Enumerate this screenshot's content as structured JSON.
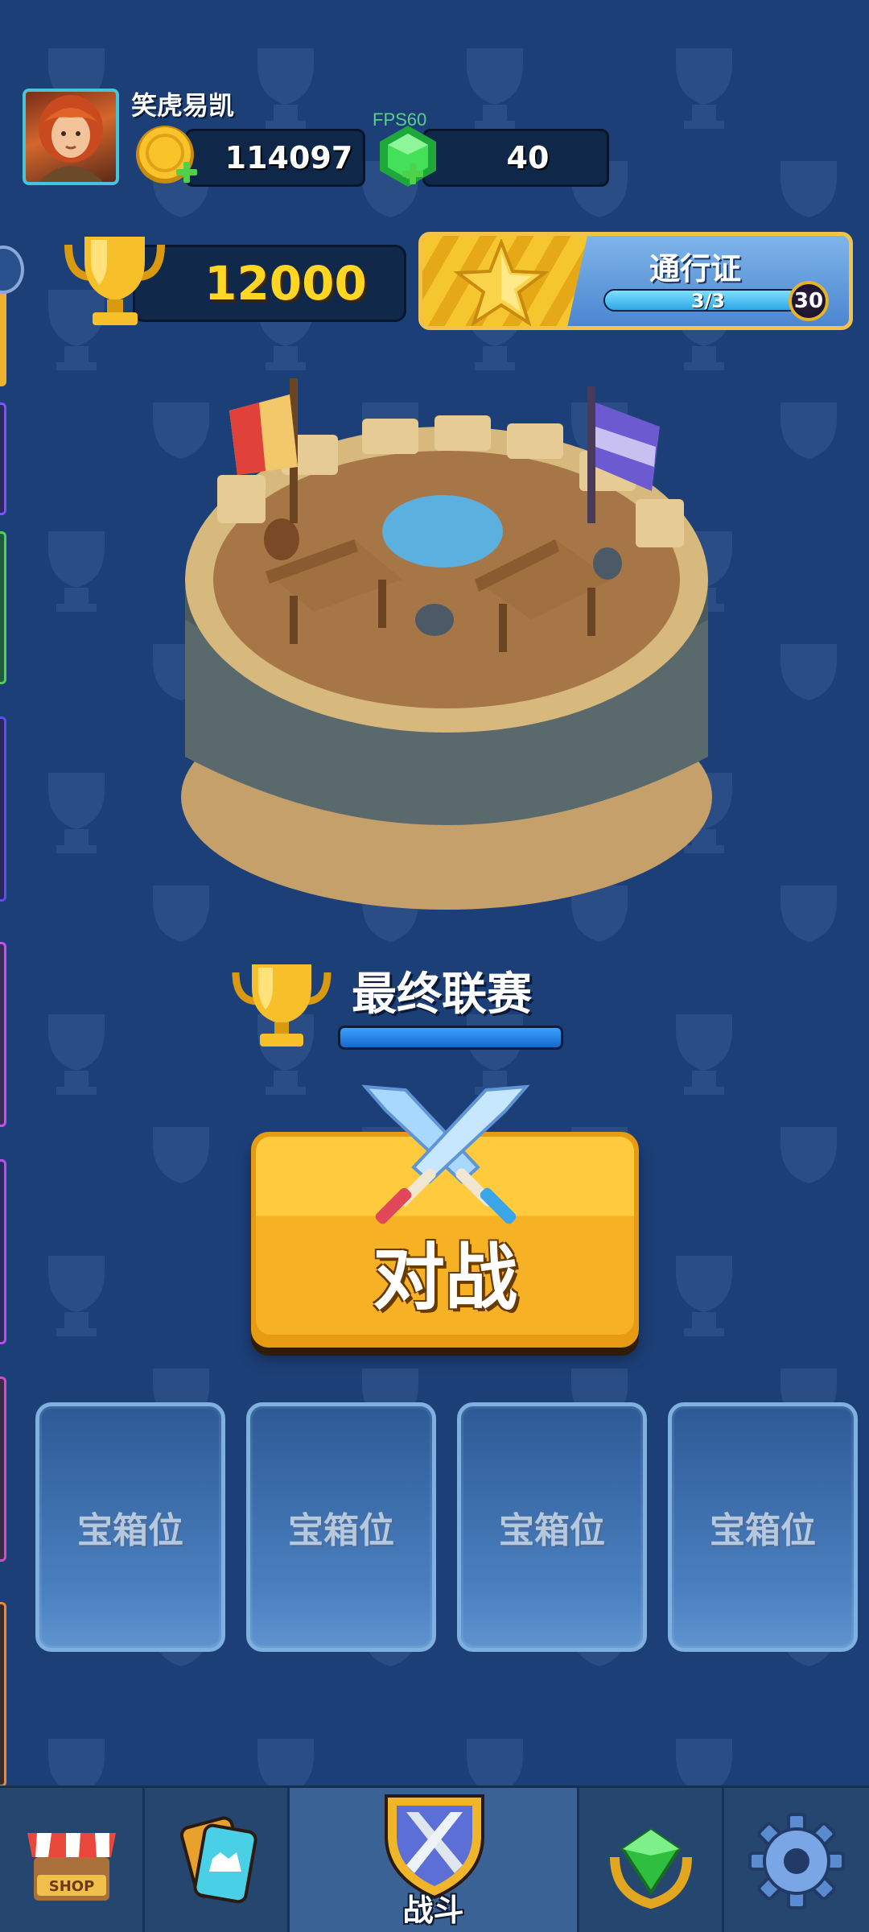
{
  "player": {
    "name": "笑虎易凯"
  },
  "currencies": {
    "coins": "114097",
    "gems": "40",
    "fps": "FPS60"
  },
  "trophies": {
    "count": "12000"
  },
  "pass": {
    "title": "通行证",
    "progress": "3/3",
    "progress_fraction": 1.0,
    "level": "30"
  },
  "league": {
    "name": "最终联赛",
    "progress_fraction": 1.0
  },
  "battle": {
    "label": "对战"
  },
  "chest_slots": [
    {
      "label": "宝箱位"
    },
    {
      "label": "宝箱位"
    },
    {
      "label": "宝箱位"
    },
    {
      "label": "宝箱位"
    }
  ],
  "nav": {
    "shop_sign": "SHOP",
    "battle_label": "战斗",
    "items": [
      "shop",
      "cards",
      "battle",
      "gem",
      "settings"
    ]
  },
  "colors": {
    "background": "#1d3f78",
    "trophy_text": "#ffd622",
    "battle_button": "#f6b124",
    "fps_text": "#56d08a"
  }
}
